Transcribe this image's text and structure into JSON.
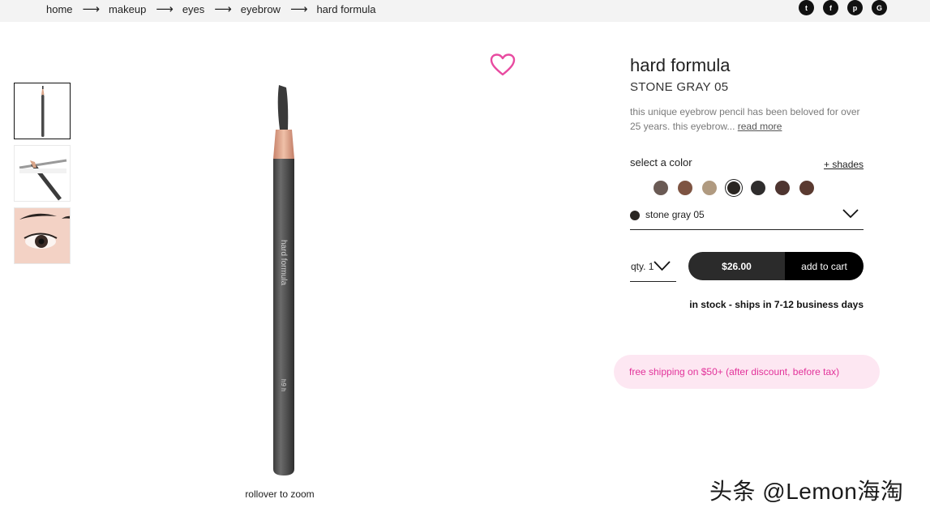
{
  "breadcrumb": {
    "items": [
      "home",
      "makeup",
      "eyes",
      "eyebrow",
      "hard formula"
    ],
    "separator": "⟶"
  },
  "social": {
    "icons": [
      "twitter-icon",
      "facebook-icon",
      "pinterest-icon",
      "google-icon"
    ],
    "glyphs": [
      "t",
      "f",
      "p",
      "G"
    ]
  },
  "gallery": {
    "thumbnails": [
      "pencil-front",
      "pencils-crossed",
      "eyebrow-model"
    ],
    "active_index": 0,
    "zoom_hint": "rollover to zoom",
    "pencil_imprint_top": "hard formula",
    "pencil_imprint_bottom": "h9 h"
  },
  "product": {
    "title": "hard formula",
    "shade": "STONE GRAY 05",
    "description": "this unique eyebrow pencil has been beloved for over 25 years. this eyebrow...",
    "read_more": "read more",
    "select_color_label": "select a color",
    "shades_link": "+ shades",
    "swatches": [
      {
        "color": "#6a5a54",
        "selected": false
      },
      {
        "color": "#7e5442",
        "selected": false
      },
      {
        "color": "#b09a80",
        "selected": false
      },
      {
        "color": "#2a2622",
        "selected": true
      },
      {
        "color": "#2f2d2d",
        "selected": false
      },
      {
        "color": "#4e3530",
        "selected": false
      },
      {
        "color": "#5a3a30",
        "selected": false
      }
    ],
    "selected_color_name": "stone gray 05",
    "qty_label": "qty. 1",
    "price": "$26.00",
    "add_to_cart": "add to cart",
    "stock_status": "in stock - ships in 7-12 business days",
    "shipping_banner": "free shipping on $50+ (after discount, before tax)"
  },
  "watermark": "头条 @Lemon海淘",
  "colors": {
    "accent_pink": "#e2329a",
    "banner_bg": "#fde7f2",
    "heart": "#e84aa0",
    "button_dark": "#2b2b2b"
  }
}
